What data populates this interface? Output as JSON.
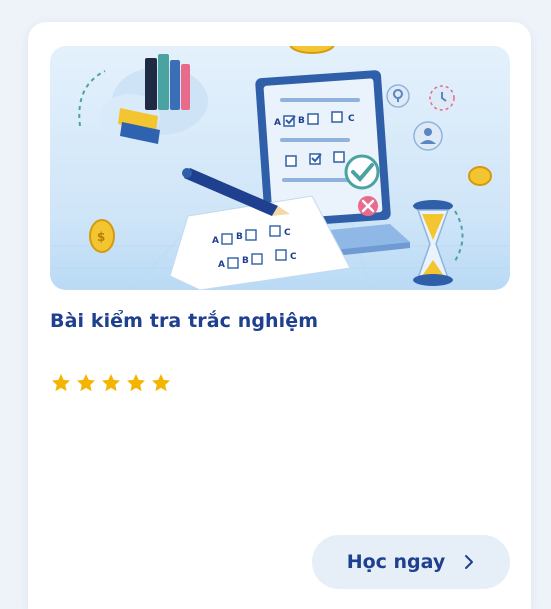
{
  "course_card": {
    "title": "Bài kiểm tra trắc nghiệm",
    "rating": 5,
    "rating_max": 5,
    "cta_label": "Học ngay",
    "banner_labels": [
      "A",
      "B",
      "C",
      "A",
      "B",
      "C",
      "A",
      "B",
      "C"
    ]
  },
  "colors": {
    "title": "#1f3f8f",
    "star": "#f5b400",
    "button_bg": "#e6eef8",
    "banner_bg": "#d6ebfb"
  },
  "icons": {
    "rating": "star-icon",
    "cta": "chevron-right-icon"
  }
}
